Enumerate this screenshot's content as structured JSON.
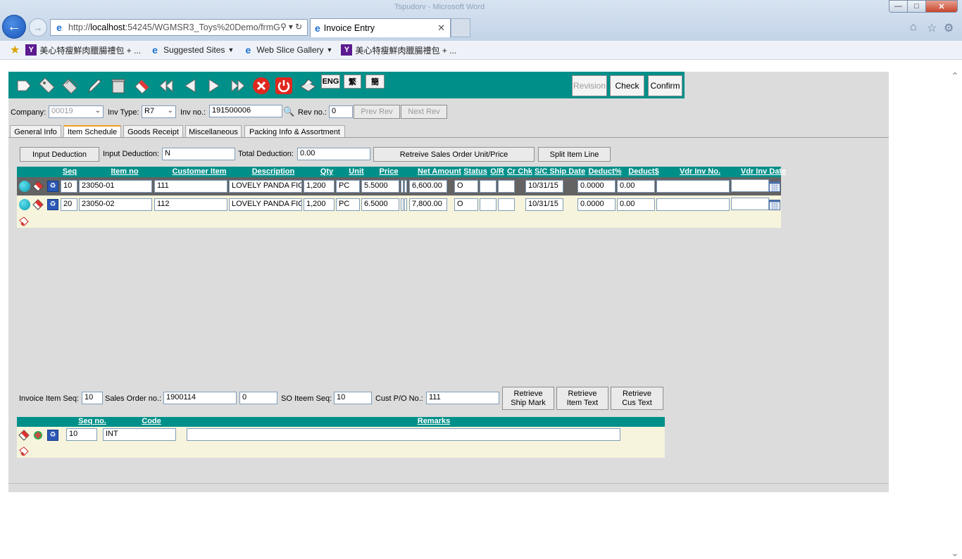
{
  "window": {
    "title": "Tspudorv - Microsoft Word"
  },
  "browser": {
    "url_prefix": "http://",
    "url_host": "localhost",
    "url_rest": ":54245/WGMSR3_Toys%20Demo/frmG",
    "tab_title": "Invoice Entry",
    "favorites": [
      {
        "label": "美心特瘦鮮肉臘腸禮包 + ..."
      },
      {
        "label": "Suggested Sites"
      },
      {
        "label": "Web Slice Gallery"
      },
      {
        "label": "美心特瘦鮮肉臘腸禮包 + ..."
      }
    ]
  },
  "toolbar": {
    "lang": [
      "ENG",
      "繁",
      "簡"
    ],
    "revision": "Revision",
    "check": "Check",
    "confirm": "Confirm"
  },
  "header": {
    "company_label": "Company:",
    "company_value": "00019",
    "invtype_label": "Inv Type:",
    "invtype_value": "R7",
    "invno_label": "Inv no.:",
    "invno_value": "191500006",
    "revno_label": "Rev no.:",
    "revno_value": "0",
    "prev_rev": "Prev Rev",
    "next_rev": "Next Rev"
  },
  "tabs": [
    "General Info",
    "Item Schedule",
    "Goods Receipt",
    "Miscellaneous",
    "Packing Info & Assortment"
  ],
  "deduction": {
    "input_btn": "Input Deduction",
    "input_label": "Input Deduction:",
    "input_value": "N",
    "total_label": "Total Deduction:",
    "total_value": "0.00",
    "retrieve_btn": "Retreive Sales Order Unit/Price",
    "split_btn": "Split Item Line"
  },
  "items": {
    "columns": [
      "Seq",
      "Item no",
      "Customer Item",
      "Description",
      "Qty",
      "Unit",
      "Price",
      "Net Amount",
      "Status",
      "O/R",
      "Cr Chk",
      "S/C Ship Date",
      "Deduct%",
      "Deduct$",
      "Vdr Inv No.",
      "Vdr Inv Date"
    ],
    "rows": [
      {
        "seq": "10",
        "item_no": "23050-01",
        "cust_item": "111",
        "desc": "LOVELY PANDA FIG",
        "qty": "1,200",
        "unit": "PC",
        "price": "5.5000",
        "net": "6,600.00",
        "status": "O",
        "or": "",
        "crchk": "",
        "ship": "10/31/15",
        "dpct": "0.0000",
        "damt": "0.00",
        "vinv": "",
        "vdate": ""
      },
      {
        "seq": "20",
        "item_no": "23050-02",
        "cust_item": "112",
        "desc": "LOVELY PANDA FIG",
        "qty": "1,200",
        "unit": "PC",
        "price": "6.5000",
        "net": "7,800.00",
        "status": "O",
        "or": "",
        "crchk": "",
        "ship": "10/31/15",
        "dpct": "0.0000",
        "damt": "0.00",
        "vinv": "",
        "vdate": ""
      }
    ]
  },
  "detail": {
    "inv_seq_label": "Invoice Item Seq:",
    "inv_seq_value": "10",
    "so_label": "Sales Order no.:",
    "so_value": "1900114",
    "so_rev_value": "0",
    "so_seq_label": "SO Iteem Seq:",
    "so_seq_value": "10",
    "cust_po_label": "Cust P/O No.:",
    "cust_po_value": "111",
    "btn_ship_mark": "Retrieve\nShip Mark",
    "btn_item_text": "Retrieve\nItem Text",
    "btn_cus_text": "Retrieve\nCus Text"
  },
  "remarks": {
    "columns": [
      "Seq no.",
      "Code",
      "Remarks"
    ],
    "row": {
      "seq": "10",
      "code": "INT",
      "remarks": ""
    }
  },
  "colors": {
    "teal": "#009089",
    "panel": "#dcdcdc",
    "gridbody": "#f6f4dc"
  }
}
